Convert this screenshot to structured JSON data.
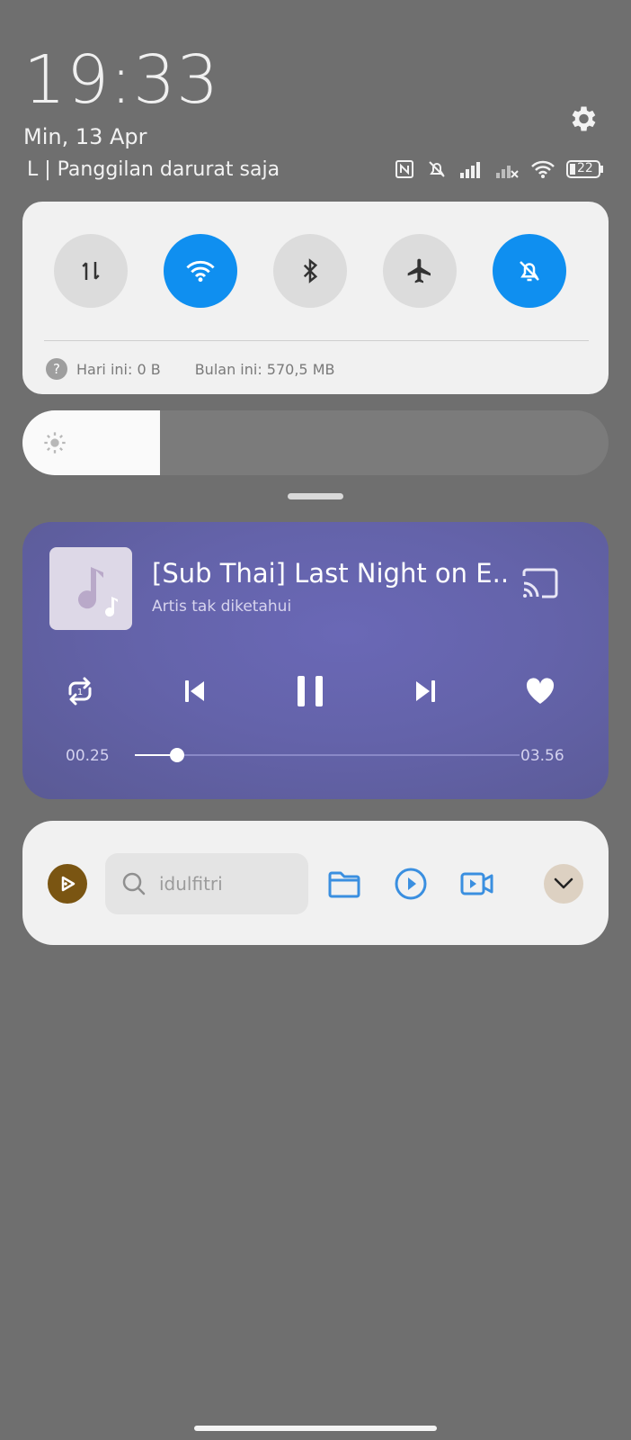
{
  "header": {
    "time": "19:33",
    "date": "Min, 13 Apr",
    "carrier_text": "L | Panggilan darurat saja",
    "battery": "22"
  },
  "status_icons": [
    "nfc-icon",
    "silent-icon",
    "signal-icon",
    "signal-x-icon",
    "wifi-icon",
    "battery-icon"
  ],
  "quick_panel": {
    "toggles": [
      {
        "name": "mobile-data",
        "active": false
      },
      {
        "name": "wifi",
        "active": true
      },
      {
        "name": "bluetooth",
        "active": false
      },
      {
        "name": "airplane-mode",
        "active": false
      },
      {
        "name": "silent",
        "active": true
      }
    ],
    "data_today": "Hari ini: 0 B",
    "data_month": "Bulan ini: 570,5 MB",
    "help_glyph": "?"
  },
  "brightness": {
    "level": 0.235
  },
  "media": {
    "title": "[Sub Thai] Last Night on E...",
    "artist": "Artis tak diketahui",
    "current_time": "00.25",
    "total_time": "03.56",
    "progress": 0.11
  },
  "file_bar": {
    "search_placeholder": "idulfitri"
  },
  "colors": {
    "accent_blue": "#0f8ff0",
    "media_bg": "#6463aa",
    "panel_bg": "#f1f1f1",
    "background": "#6f6f6f",
    "app_icon_blue": "#3a8fe0",
    "logo_brown": "#7a5512"
  }
}
